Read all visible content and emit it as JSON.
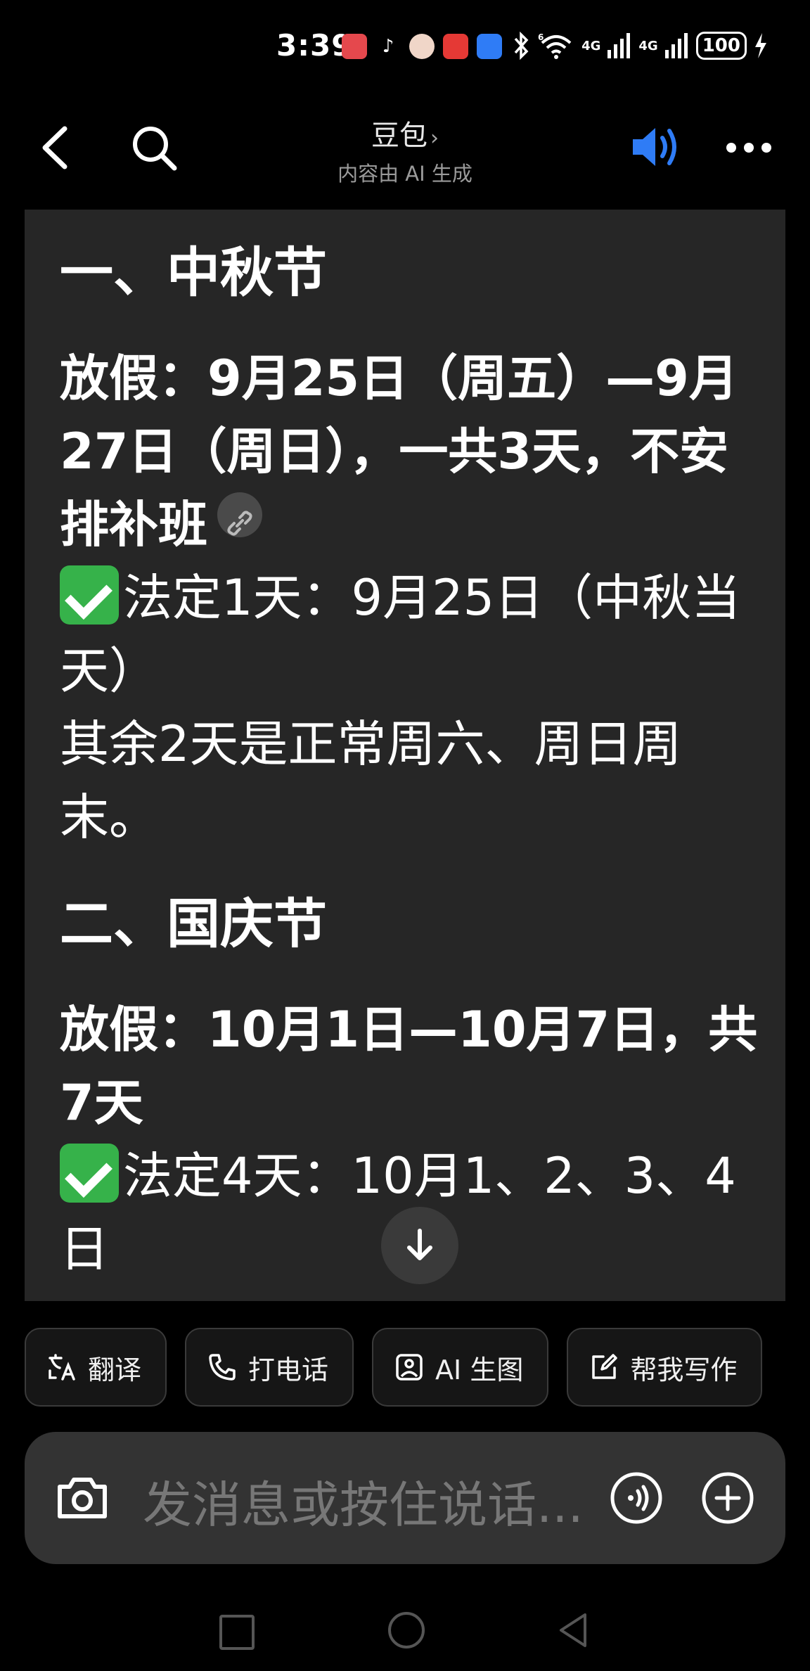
{
  "status_bar": {
    "time": "3:39",
    "battery": "100",
    "signal_1": "4G",
    "signal_2": "4G",
    "wifi": "6"
  },
  "header": {
    "title": "豆包",
    "chevron": "›",
    "subtitle": "内容由 AI 生成",
    "icons": [
      "back-icon",
      "search-icon",
      "speaker-icon",
      "more-icon"
    ],
    "accent_color": "#2f7cf6"
  },
  "message": {
    "section1_title": "一、中秋节",
    "section1_holiday": "放假：9月25日（周五）—9月27日（周日），一共3天，不安排补班",
    "section1_legal": "法定1天：9月25日（中秋当天）",
    "section1_note": "其余2天是正常周六、周日周末。",
    "section2_title": "二、国庆节",
    "section2_holiday": "放假：10月1日—10月7日，共7天",
    "section2_legal": "法定4天：10月1、2、3、4日"
  },
  "chips": [
    {
      "label": "翻译",
      "icon": "translate-icon"
    },
    {
      "label": "打电话",
      "icon": "phone-icon"
    },
    {
      "label": "AI 生图",
      "icon": "image-icon"
    },
    {
      "label": "帮我写作",
      "icon": "edit-icon"
    }
  ],
  "input": {
    "placeholder": "发消息或按住说话..."
  }
}
